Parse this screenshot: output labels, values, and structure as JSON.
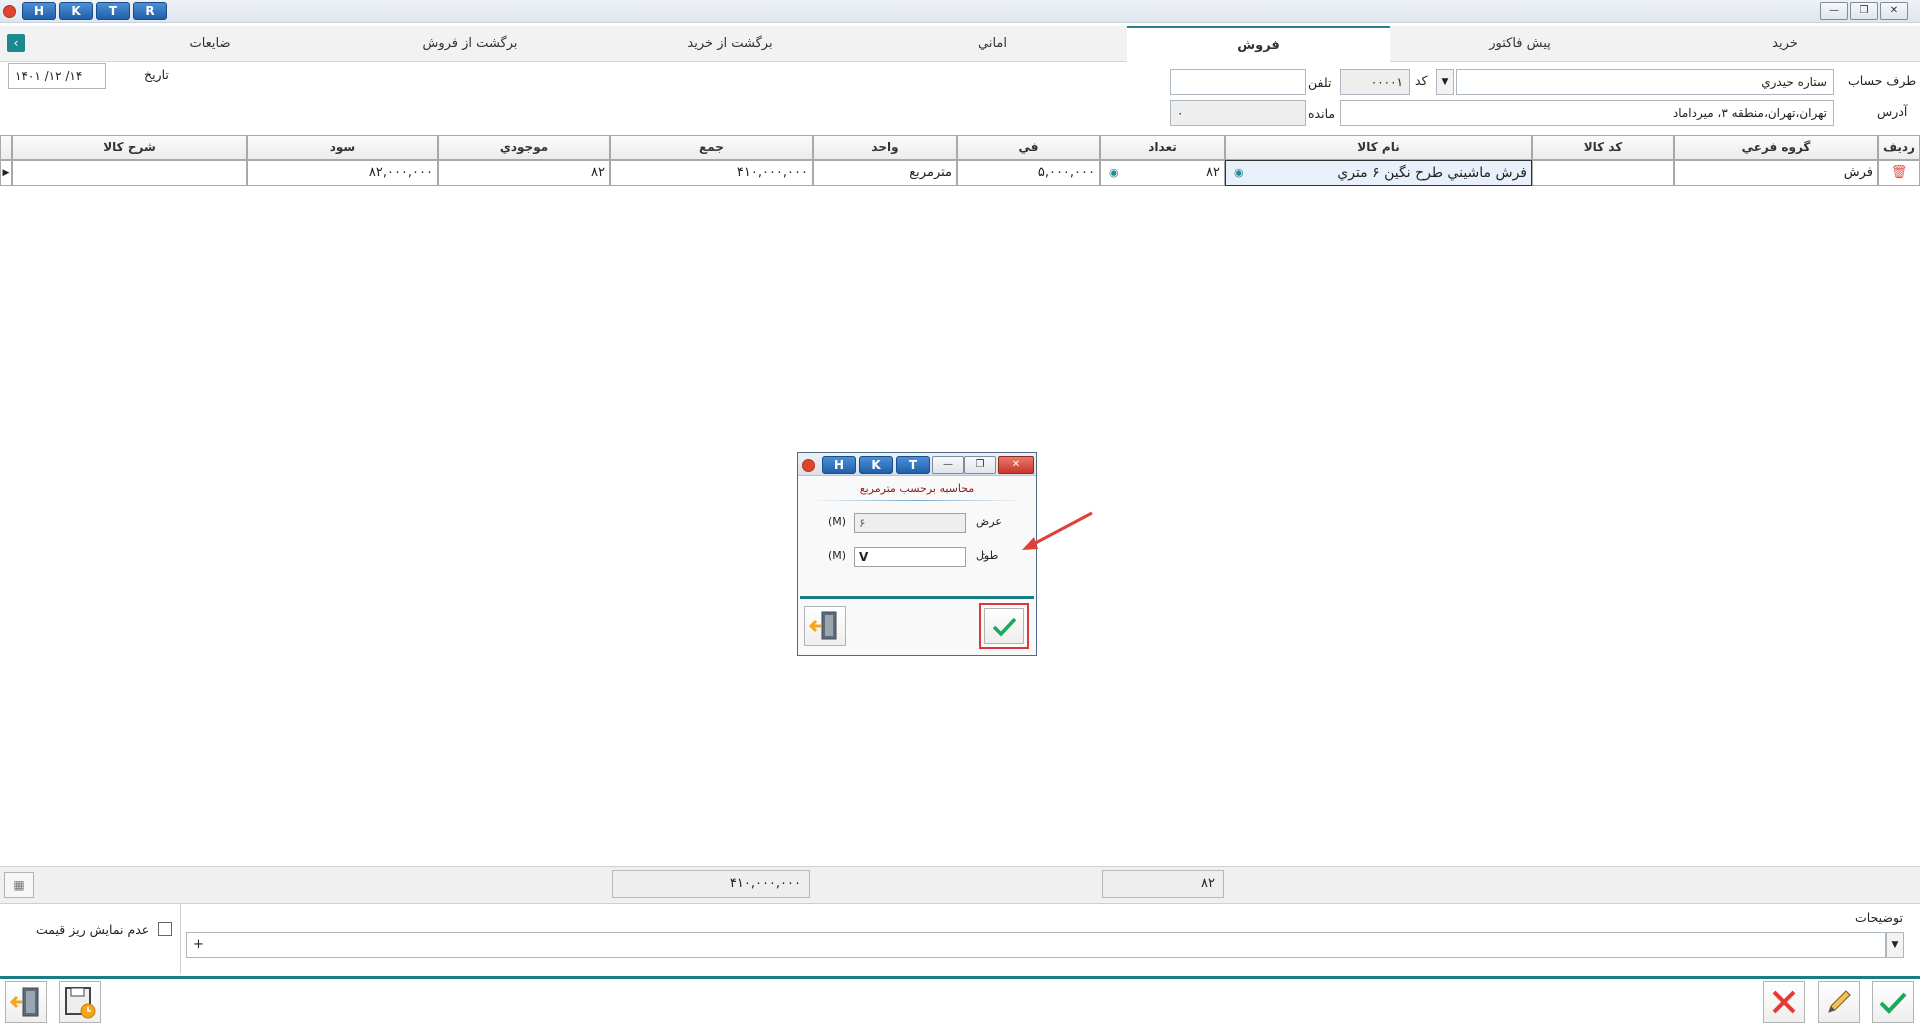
{
  "titlebar": {
    "letters": [
      "H",
      "K",
      "T",
      "R"
    ],
    "min": "—",
    "restore": "❐",
    "close": "✕"
  },
  "tabs": [
    {
      "label": "خريد"
    },
    {
      "label": "پيش فاكتور"
    },
    {
      "label": "فروش"
    },
    {
      "label": "اماني"
    },
    {
      "label": "برگشت از خريد"
    },
    {
      "label": "برگشت از فروش"
    },
    {
      "label": "ضايعات"
    }
  ],
  "header": {
    "account_label": "طرف حساب",
    "account_value": "ستاره حيدري",
    "code_label": "كد",
    "code_value": "۰۰۰۰۱",
    "phone_label": "تلفن",
    "phone_value": "",
    "date_label": "تاريخ",
    "date_value": "۱۴۰۱ /۱۲ /۱۴",
    "address_label": "آدرس",
    "address_value": "تهران،تهران،منطقه ۳، ميرداماد",
    "remain_label": "مانده",
    "remain_value": "۰"
  },
  "grid": {
    "columns": [
      "رديف",
      "گروه فرعي",
      "كد كالا",
      "نام كالا",
      "تعداد",
      "في",
      "واحد",
      "جمع",
      "موجودي",
      "سود",
      "شرح كالا"
    ],
    "row": {
      "group": "فرش",
      "code": "",
      "name": "فرش ماشيني طرح نگين ۶ متري",
      "qty": "۸۲",
      "price": "۵,۰۰۰,۰۰۰",
      "unit": "مترمربع",
      "total": "۴۱۰,۰۰۰,۰۰۰",
      "stock": "۸۲",
      "profit": "۸۲,۰۰۰,۰۰۰",
      "desc": ""
    }
  },
  "totals": {
    "sum": "۴۱۰,۰۰۰,۰۰۰",
    "qty": "۸۲"
  },
  "footer": {
    "notes_label": "توضيحات",
    "notes_value": "+",
    "hide_price_label": "عدم نمايش ريز قيمت"
  },
  "dialog": {
    "letters": [
      "H",
      "K",
      "T"
    ],
    "heading": "محاسبه برحسب مترمربع",
    "width_label": "عرض",
    "width_value": "۶",
    "length_label": "طول",
    "length_value": "V",
    "unit": "(M)",
    "colon": ":"
  },
  "colors": {
    "accent": "#1a8a8e",
    "red_x": "#e53935",
    "green_check": "#1aa85a"
  }
}
